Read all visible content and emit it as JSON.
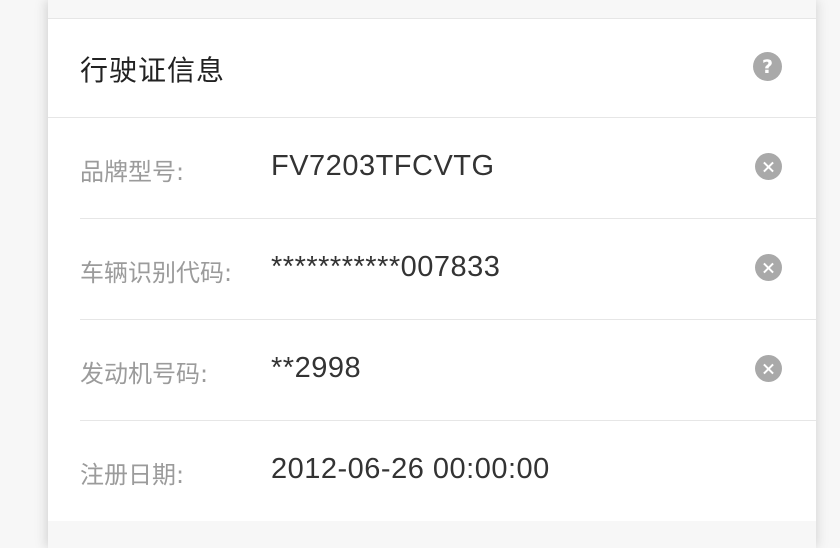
{
  "section": {
    "title": "行驶证信息",
    "help_icon": "help-icon"
  },
  "fields": [
    {
      "label": "品牌型号:",
      "value": "FV7203TFCVTG",
      "clearable": true
    },
    {
      "label": "车辆识别代码:",
      "value": "***********007833",
      "clearable": true
    },
    {
      "label": "发动机号码:",
      "value": "**2998",
      "clearable": true
    },
    {
      "label": "注册日期:",
      "value": "2012-06-26 00:00:00",
      "clearable": false
    }
  ],
  "colors": {
    "background": "#f7f7f7",
    "card": "#ffffff",
    "label": "#9b9b9b",
    "value": "#333333",
    "icon": "#a9a9a9",
    "divider": "#e6e6e6"
  }
}
